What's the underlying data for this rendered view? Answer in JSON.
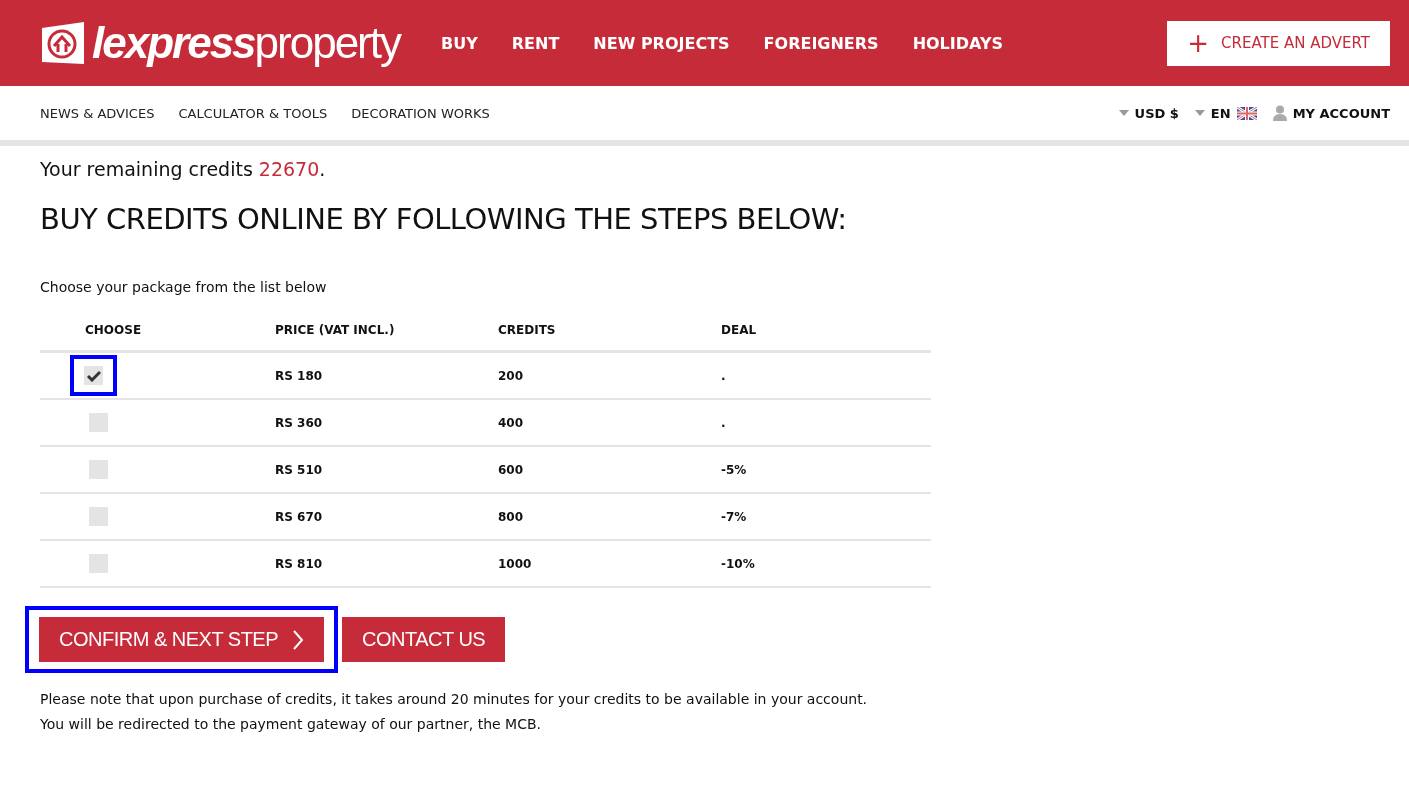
{
  "logo": {
    "bold": "lexpress",
    "light": "property"
  },
  "main_nav": [
    "BUY",
    "RENT",
    "NEW PROJECTS",
    "FOREIGNERS",
    "HOLIDAYS"
  ],
  "create_button": {
    "icon": "+",
    "label": "CREATE AN ADVERT"
  },
  "sub_nav": [
    "NEWS & ADVICES",
    "CALCULATOR & TOOLS",
    "DECORATION WORKS"
  ],
  "currency": "USD $",
  "language": "EN",
  "account": "MY ACCOUNT",
  "credits": {
    "text": "Your remaining credits",
    "value": "22670",
    "end": "."
  },
  "heading": "BUY CREDITS ONLINE BY FOLLOWING THE STEPS BELOW:",
  "intro": "Choose your package from the list below",
  "table": {
    "columns": [
      "CHOOSE",
      "PRICE (VAT INCL.)",
      "CREDITS",
      "DEAL"
    ],
    "rows": [
      {
        "price": "RS 180",
        "credits": "200",
        "deal": ".",
        "checked": true,
        "highlighted": true
      },
      {
        "price": "RS 360",
        "credits": "400",
        "deal": ".",
        "checked": false,
        "highlighted": false
      },
      {
        "price": "RS 510",
        "credits": "600",
        "deal": "-5%",
        "checked": false,
        "highlighted": false
      },
      {
        "price": "RS 670",
        "credits": "800",
        "deal": "-7%",
        "checked": false,
        "highlighted": false
      },
      {
        "price": "RS 810",
        "credits": "1000",
        "deal": "-10%",
        "checked": false,
        "highlighted": false
      }
    ]
  },
  "confirm_button": {
    "label": "CONFIRM & NEXT STEP",
    "highlighted": true
  },
  "contact_button": {
    "label": "CONTACT US"
  },
  "notes": [
    "Please note that upon purchase of credits, it takes around 20 minutes for your credits to be available in your account.",
    "You will be redirected to the payment gateway of our partner, the MCB."
  ]
}
